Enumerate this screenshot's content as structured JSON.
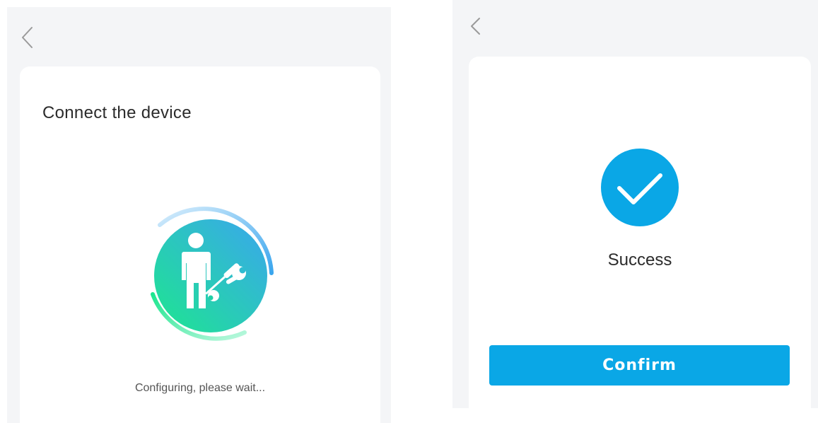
{
  "configure_screen": {
    "back_icon": "chevron-left-icon",
    "title": "Connect the device",
    "illustration_icon": "technician-with-tools-icon",
    "status": "Configuring, please wait..."
  },
  "success_screen": {
    "back_icon": "chevron-left-icon",
    "status_icon": "check-circle-icon",
    "status": "Success",
    "confirm_label": "Confirm"
  },
  "colors": {
    "screen_background": "#f4f5f7",
    "card_background": "#ffffff",
    "accent_blue": "#0aa7e6",
    "gradient_green": "#1de68f",
    "gradient_blue": "#3aa6ee",
    "text_dark": "#2b2b2b",
    "text_muted": "#555555"
  }
}
